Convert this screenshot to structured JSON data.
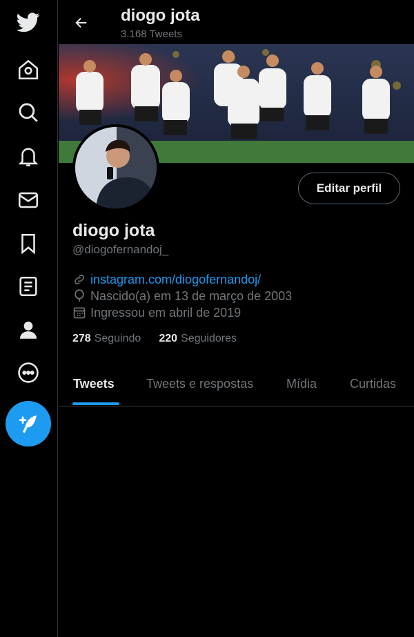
{
  "nav": {
    "items": [
      "twitter-logo",
      "home",
      "explore",
      "notifications",
      "messages",
      "bookmarks",
      "lists",
      "profile",
      "more"
    ],
    "compose_label": "Tweet"
  },
  "header": {
    "name": "diogo jota",
    "tweet_count": "3.168 Tweets"
  },
  "profile": {
    "edit_button": "Editar perfil",
    "name": "diogo jota",
    "handle": "@diogofernandoj_",
    "website": "instagram.com/diogofernandoj/",
    "birth": "Nascido(a) em 13 de março de 2003",
    "joined": "Ingressou em abril de 2019",
    "following_count": "278",
    "following_label": "Seguindo",
    "followers_count": "220",
    "followers_label": "Seguidores"
  },
  "tabs": [
    {
      "label": "Tweets",
      "active": true
    },
    {
      "label": "Tweets e respostas",
      "active": false
    },
    {
      "label": "Mídia",
      "active": false
    },
    {
      "label": "Curtidas",
      "active": false
    }
  ],
  "colors": {
    "accent": "#1d9bf0",
    "background": "#000000",
    "text": "#e7e9ea",
    "muted": "#71767b",
    "border": "#2f3336"
  }
}
